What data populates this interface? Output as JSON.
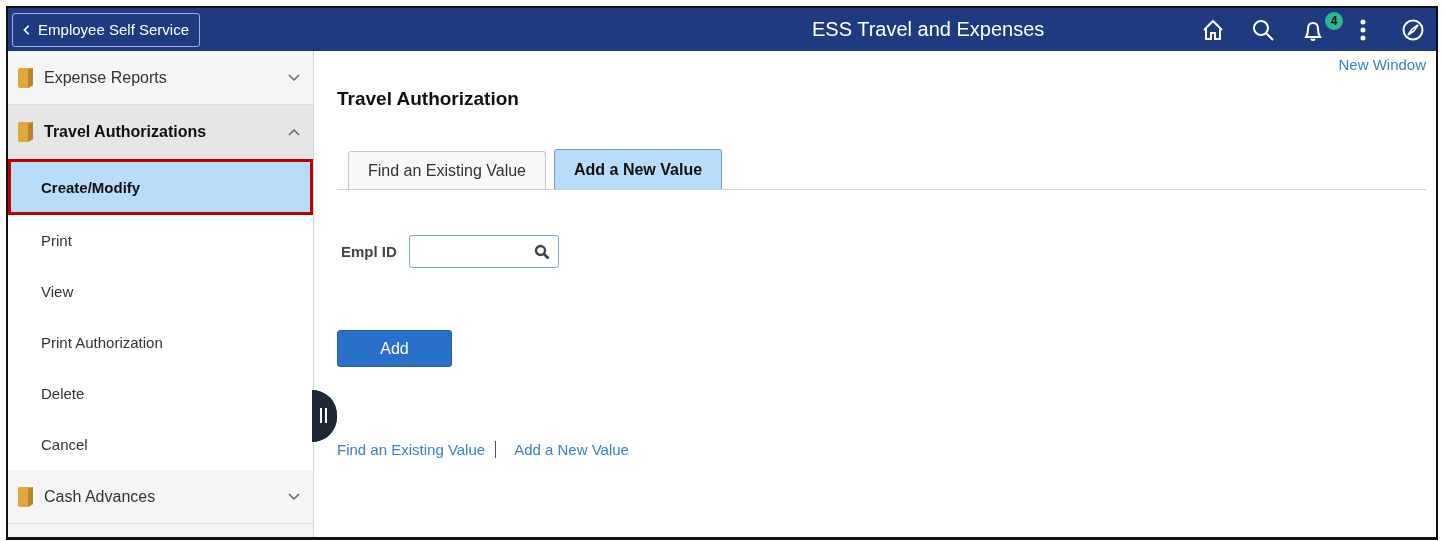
{
  "header": {
    "back_button": "Employee Self Service",
    "title": "ESS Travel and Expenses",
    "notification_count": "4"
  },
  "sidebar": {
    "groups": [
      {
        "label": "Expense Reports",
        "expanded": false
      },
      {
        "label": "Travel Authorizations",
        "expanded": true,
        "children": [
          {
            "label": "Create/Modify",
            "selected": true
          },
          {
            "label": "Print",
            "selected": false
          },
          {
            "label": "View",
            "selected": false
          },
          {
            "label": "Print Authorization",
            "selected": false
          },
          {
            "label": "Delete",
            "selected": false
          },
          {
            "label": "Cancel",
            "selected": false
          }
        ]
      },
      {
        "label": "Cash Advances",
        "expanded": false
      }
    ]
  },
  "content": {
    "new_window_link": "New Window",
    "page_title": "Travel Authorization",
    "tabs": [
      {
        "label": "Find an Existing Value",
        "selected": false
      },
      {
        "label": "Add a New Value",
        "selected": true
      }
    ],
    "field": {
      "label": "Empl ID"
    },
    "add_button": "Add",
    "footer_links": [
      "Find an Existing Value",
      "Add a New Value"
    ]
  }
}
